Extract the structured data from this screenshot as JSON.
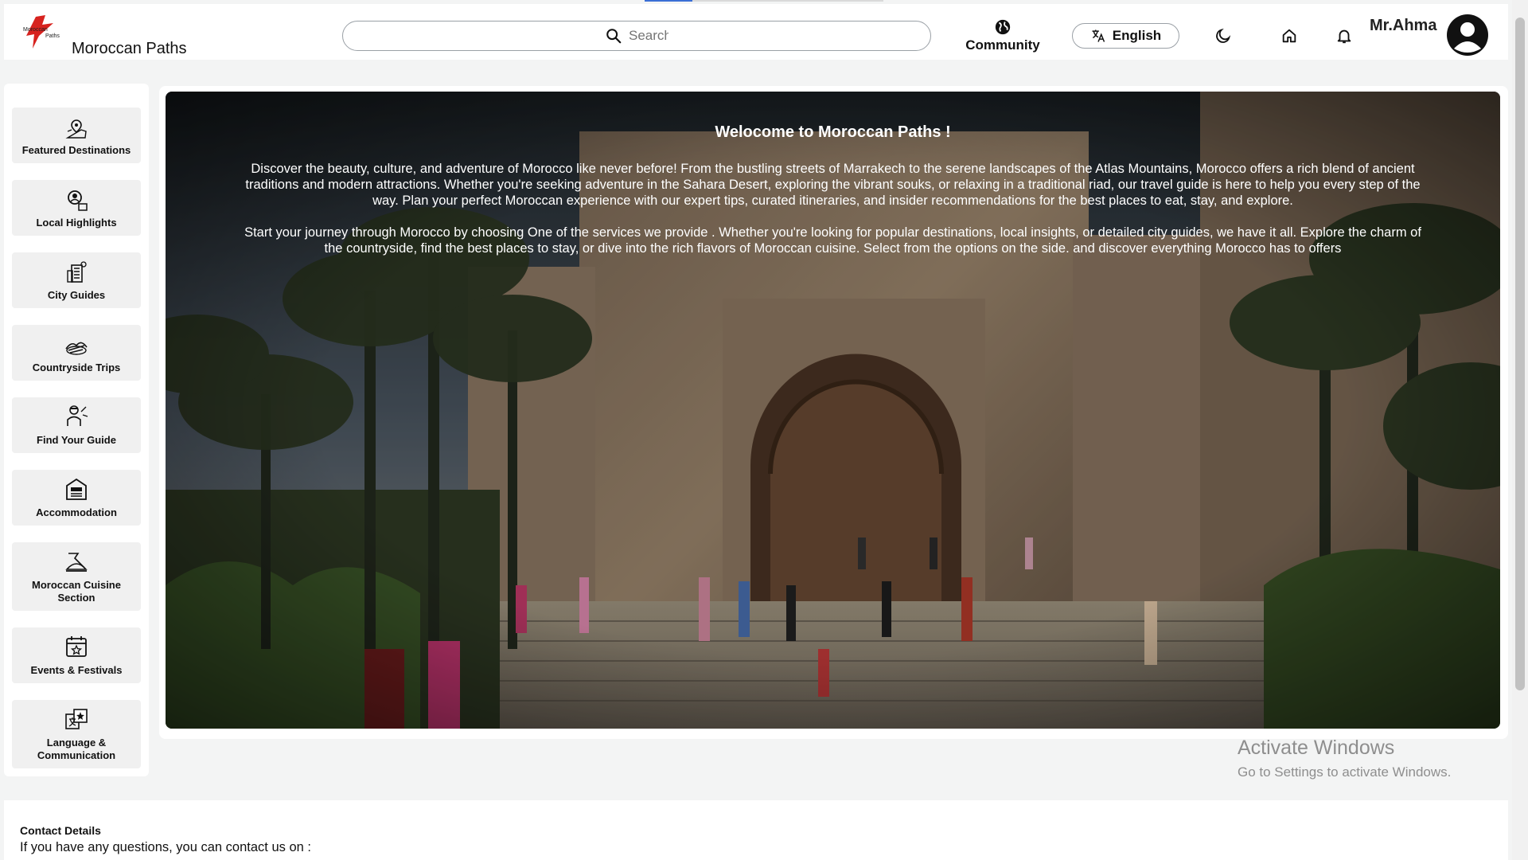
{
  "header": {
    "brand_name": "Moroccan Paths",
    "logo_text_top": "Moroccan",
    "logo_text_bottom": "Paths",
    "search_placeholder": "Search",
    "community_label": "Community",
    "language_label": "English",
    "user_name": "Mr.Ahma"
  },
  "sidebar": {
    "items": [
      {
        "label": "Featured Destinations",
        "icon": "map-pin-icon"
      },
      {
        "label": "Local Highlights",
        "icon": "location-person-icon"
      },
      {
        "label": "City Guides",
        "icon": "city-guide-icon"
      },
      {
        "label": "Countryside Trips",
        "icon": "countryside-icon"
      },
      {
        "label": "Find Your Guide",
        "icon": "guide-person-icon"
      },
      {
        "label": "Accommodation",
        "icon": "hotel-icon"
      },
      {
        "label": "Moroccan Cuisine Section",
        "icon": "cuisine-icon"
      },
      {
        "label": "Events & Festivals",
        "icon": "calendar-star-icon"
      },
      {
        "label": "Language & Communication",
        "icon": "translate-icon"
      }
    ]
  },
  "hero": {
    "title": "Welocome to Moroccan Paths !",
    "paragraph1": "Discover the beauty, culture, and adventure of Morocco like never before! From the bustling streets of Marrakech to the serene landscapes of the Atlas Mountains, Morocco offers a rich blend of ancient traditions and modern attractions. Whether you're seeking adventure in the Sahara Desert, exploring the vibrant souks, or relaxing in a traditional riad, our travel guide is here to help you every step of the way. Plan your perfect Moroccan experience with our expert tips, curated itineraries, and insider recommendations for the best places to eat, stay, and explore.",
    "paragraph2": "Start your journey through Morocco by choosing One of the services we provide . Whether you're looking for popular destinations, local insights, or detailed city guides, we have it all. Explore the charm of the countryside, find the best places to stay, or dive into the rich flavors of Moroccan cuisine. Select from the options on the side. and discover everything Morocco has to offers"
  },
  "watermark": {
    "line1": "Activate Windows",
    "line2": "Go to Settings to activate Windows."
  },
  "contact": {
    "title": "Contact Details",
    "subtitle": "If you have any questions, you can contact us on :"
  }
}
